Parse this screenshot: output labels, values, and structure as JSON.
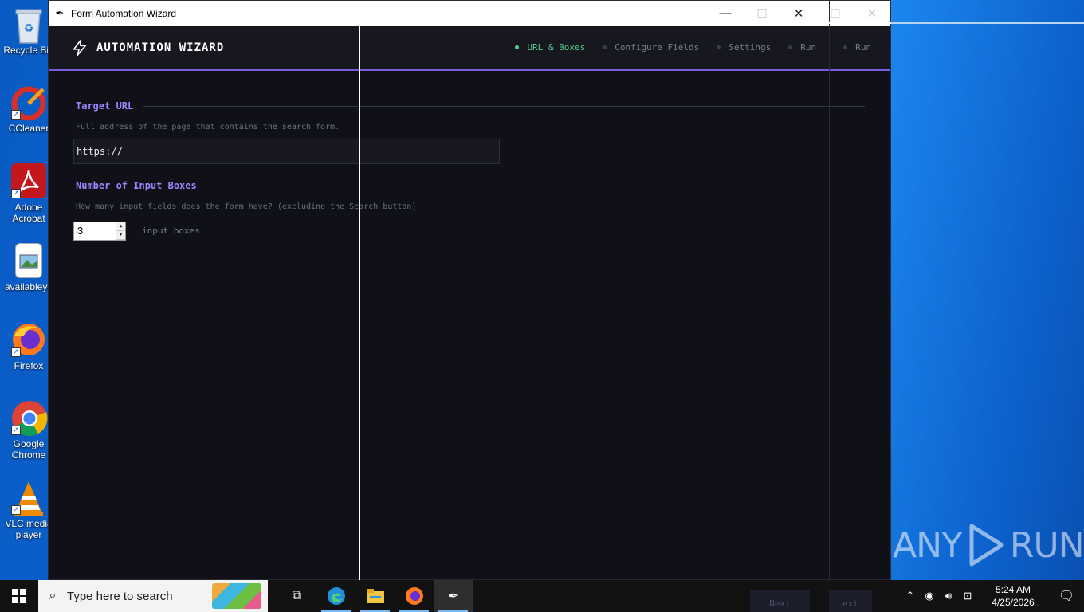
{
  "desktop": {
    "icons": [
      {
        "label": "Recycle Bin",
        "icon": "recycle-bin-icon"
      },
      {
        "label": "CCleaner",
        "icon": "ccleaner-icon"
      },
      {
        "label": "Adobe Acrobat",
        "icon": "adobe-acrobat-icon"
      },
      {
        "label": "availableye",
        "icon": "image-file-icon"
      },
      {
        "label": "Firefox",
        "icon": "firefox-icon"
      },
      {
        "label": "Google Chrome",
        "icon": "chrome-icon"
      },
      {
        "label": "VLC media player",
        "icon": "vlc-icon"
      }
    ],
    "watermark": {
      "left": "ANY",
      "right": "RUN"
    }
  },
  "window": {
    "title": "Form Automation Wizard",
    "brand": "AUTOMATION WIZARD",
    "steps": [
      {
        "label": "URL & Boxes",
        "active": true
      },
      {
        "label": "Configure Fields",
        "active": false
      },
      {
        "label": "Settings",
        "active": false
      },
      {
        "label": "Run",
        "active": false
      },
      {
        "label": "Run",
        "active": false
      }
    ],
    "url_section": {
      "heading": "Target URL",
      "help": "Full address of the page that contains the search form.",
      "value": "https://"
    },
    "boxes_section": {
      "heading": "Number of Input Boxes",
      "help": "How many input fields does the form have? (excluding the Search button)",
      "value": "3",
      "suffix": "input boxes"
    },
    "footer_ghost": {
      "next_label": "Next",
      "next2_label": "ext"
    }
  },
  "taskbar": {
    "search_placeholder": "Type here to search",
    "clock_time": "5:24 AM",
    "clock_date": "4/25/2026"
  },
  "colors": {
    "accent": "#7c5cdc",
    "heading": "#9f86ff",
    "active_step": "#4fd08a",
    "background": "#0f1018"
  }
}
